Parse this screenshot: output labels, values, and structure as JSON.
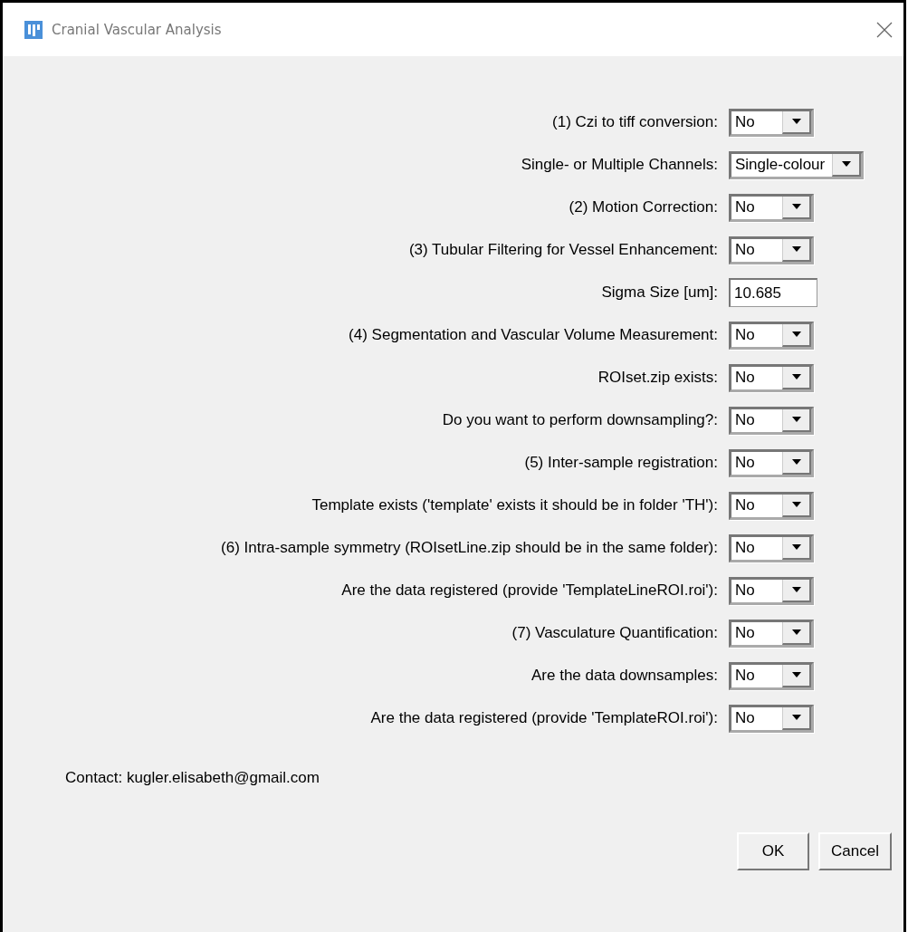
{
  "window": {
    "title": "Cranial Vascular Analysis"
  },
  "fields": [
    {
      "label": "(1) Czi to tiff conversion:",
      "kind": "dropdown",
      "value": "No"
    },
    {
      "label": "Single- or Multiple Channels:",
      "kind": "dropdown",
      "value": "Single-colour"
    },
    {
      "label": "(2) Motion Correction:",
      "kind": "dropdown",
      "value": "No"
    },
    {
      "label": "(3) Tubular Filtering for Vessel Enhancement:",
      "kind": "dropdown",
      "value": "No"
    },
    {
      "label": "Sigma Size [um]:",
      "kind": "text",
      "value": "10.685"
    },
    {
      "label": "(4) Segmentation and Vascular Volume Measurement:",
      "kind": "dropdown",
      "value": "No"
    },
    {
      "label": "ROIset.zip exists:",
      "kind": "dropdown",
      "value": "No"
    },
    {
      "label": "Do you want to perform downsampling?:",
      "kind": "dropdown",
      "value": "No"
    },
    {
      "label": "(5) Inter-sample registration:",
      "kind": "dropdown",
      "value": "No"
    },
    {
      "label": "Template exists ('template' exists it should be in folder 'TH'):",
      "kind": "dropdown",
      "value": "No"
    },
    {
      "label": "(6) Intra-sample symmetry (ROIsetLine.zip should be in the same folder):",
      "kind": "dropdown",
      "value": "No"
    },
    {
      "label": "Are the data registered (provide 'TemplateLineROI.roi'):",
      "kind": "dropdown",
      "value": "No"
    },
    {
      "label": "(7) Vasculature Quantification:",
      "kind": "dropdown",
      "value": "No"
    },
    {
      "label": "Are the data downsamples:",
      "kind": "dropdown",
      "value": "No"
    },
    {
      "label": "Are the data registered (provide 'TemplateROI.roi'):",
      "kind": "dropdown",
      "value": "No"
    }
  ],
  "contact": "Contact: kugler.elisabeth@gmail.com",
  "buttons": [
    "OK",
    "Cancel"
  ]
}
